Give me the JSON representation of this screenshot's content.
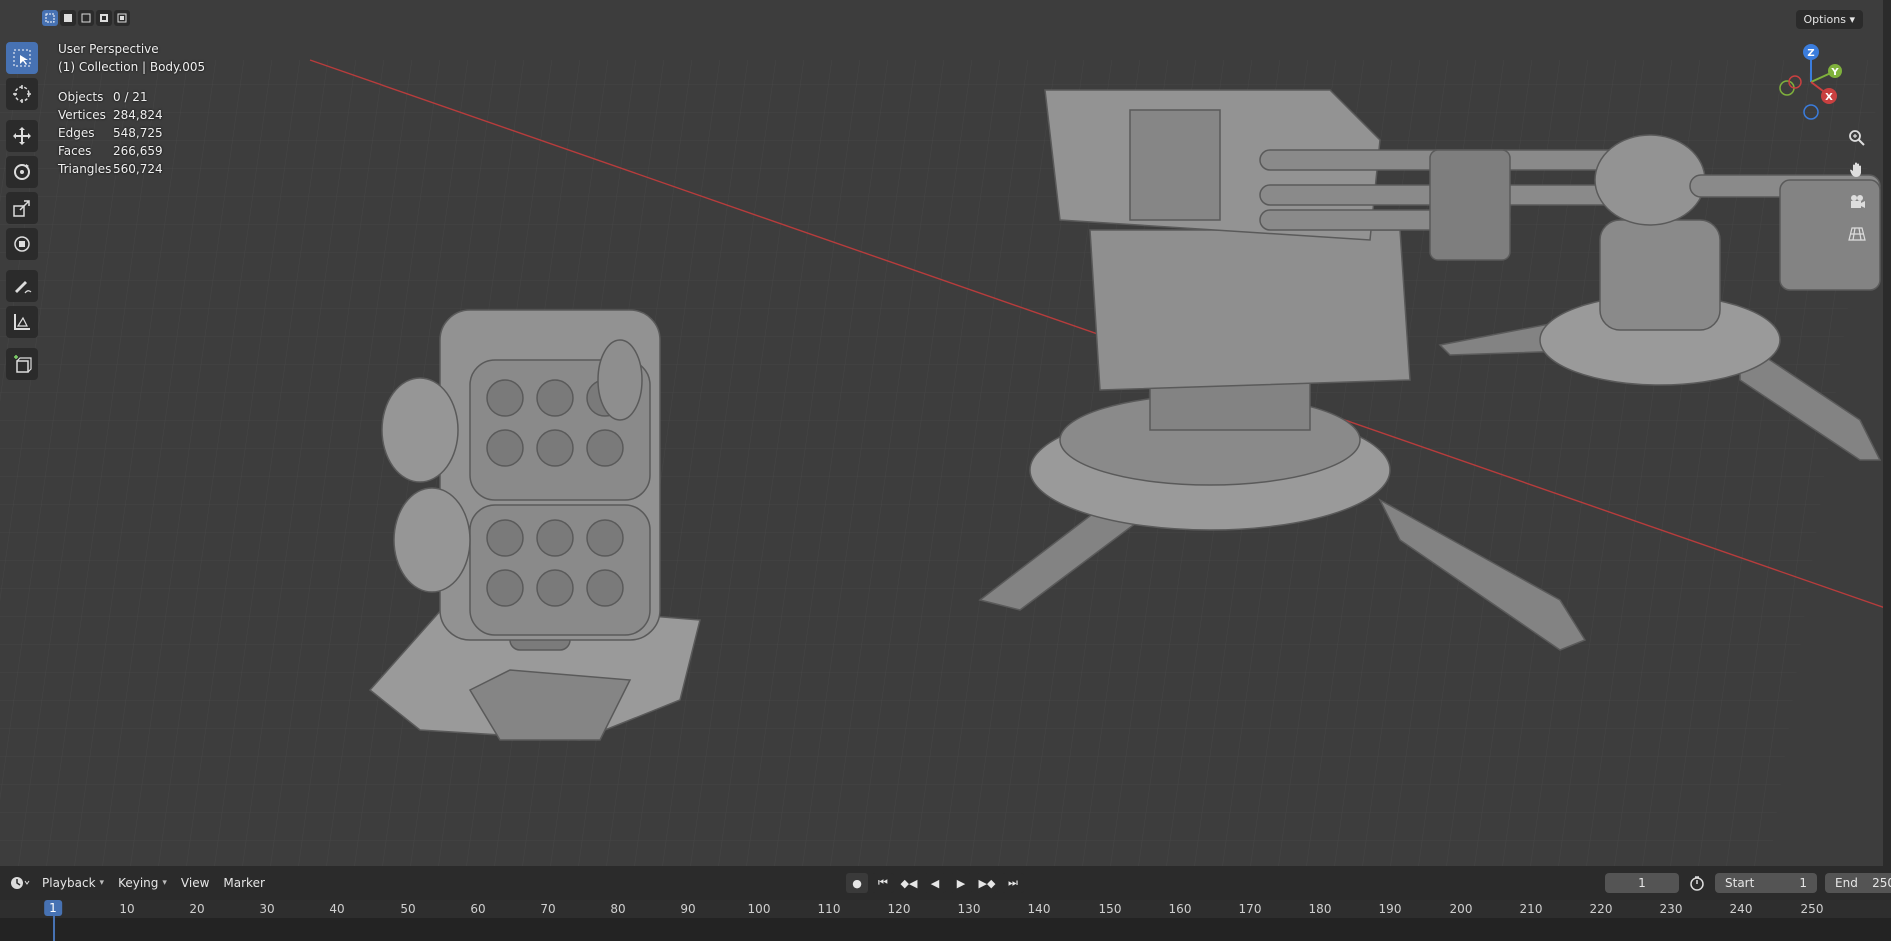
{
  "viewport": {
    "view_name": "User Perspective",
    "collection_info": "(1) Collection | Body.005",
    "options_label": "Options"
  },
  "stats": [
    {
      "label": "Objects",
      "value": "0 / 21"
    },
    {
      "label": "Vertices",
      "value": "284,824"
    },
    {
      "label": "Edges",
      "value": "548,725"
    },
    {
      "label": "Faces",
      "value": "266,659"
    },
    {
      "label": "Triangles",
      "value": "560,724"
    }
  ],
  "gizmo": {
    "z": "Z",
    "y": "Y",
    "x": "X"
  },
  "tools": [
    "select-box-icon",
    "cursor-icon",
    "move-icon",
    "rotate-icon",
    "scale-icon",
    "transform-icon",
    "annotate-icon",
    "measure-icon",
    "add-cube-icon"
  ],
  "timeline": {
    "menus": [
      "Playback",
      "Keying",
      "View",
      "Marker"
    ],
    "current_frame": "1",
    "start_label": "Start",
    "start_value": "1",
    "end_label": "End",
    "end_value": "250",
    "ruler_ticks": [
      "10",
      "20",
      "30",
      "40",
      "50",
      "60",
      "70",
      "80",
      "90",
      "100",
      "110",
      "120",
      "130",
      "140",
      "150",
      "160",
      "170",
      "180",
      "190",
      "200",
      "210",
      "220",
      "230",
      "240",
      "250"
    ],
    "playhead_label": "1"
  },
  "colors": {
    "accent": "#4772b3",
    "x_axis": "#c94040",
    "y_axis": "#7fb13c",
    "z_axis": "#3b7ddd"
  }
}
